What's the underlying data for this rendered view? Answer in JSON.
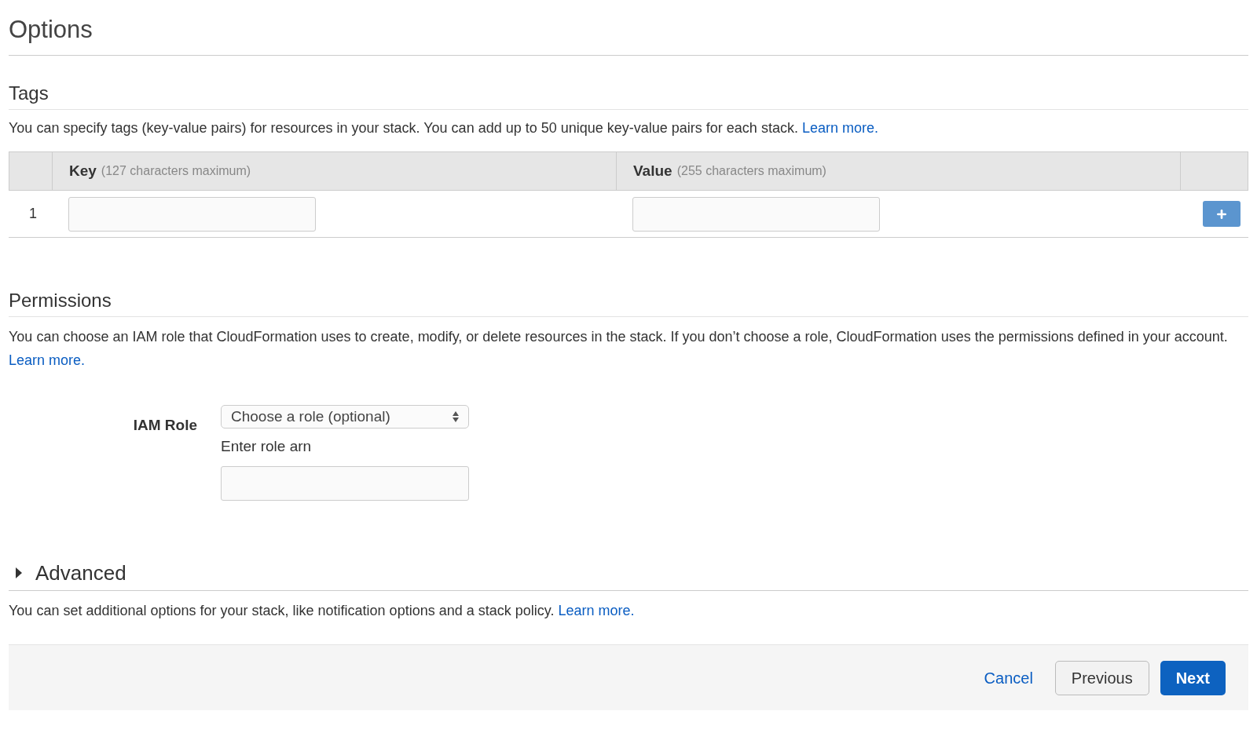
{
  "page_title": "Options",
  "tags": {
    "heading": "Tags",
    "description": "You can specify tags (key-value pairs) for resources in your stack. You can add up to 50 unique key-value pairs for each stack.",
    "link": "Learn more.",
    "columns": [
      {
        "label": "Key",
        "hint": "(127 characters maximum)"
      },
      {
        "label": "Value",
        "hint": "(255 characters maximum)"
      }
    ],
    "rows": [
      {
        "number": "1"
      }
    ]
  },
  "permissions": {
    "heading": "Permissions",
    "description": "You can choose an IAM role that CloudFormation uses to create, modify, or delete resources in the stack. If you don’t choose a role, CloudFormation uses the permissions defined in your account.",
    "link": "Learn more.",
    "role_label": "IAM Role",
    "role_select": "Choose a role (optional)",
    "arn_label": "Enter role arn"
  },
  "advanced": {
    "heading": "Advanced",
    "expanded": false,
    "description": "You can set additional options for your stack, like notification options and a stack policy.",
    "link": "Learn more."
  },
  "footer": {
    "cancel": "Cancel",
    "previous": "Previous",
    "next": "Next"
  }
}
